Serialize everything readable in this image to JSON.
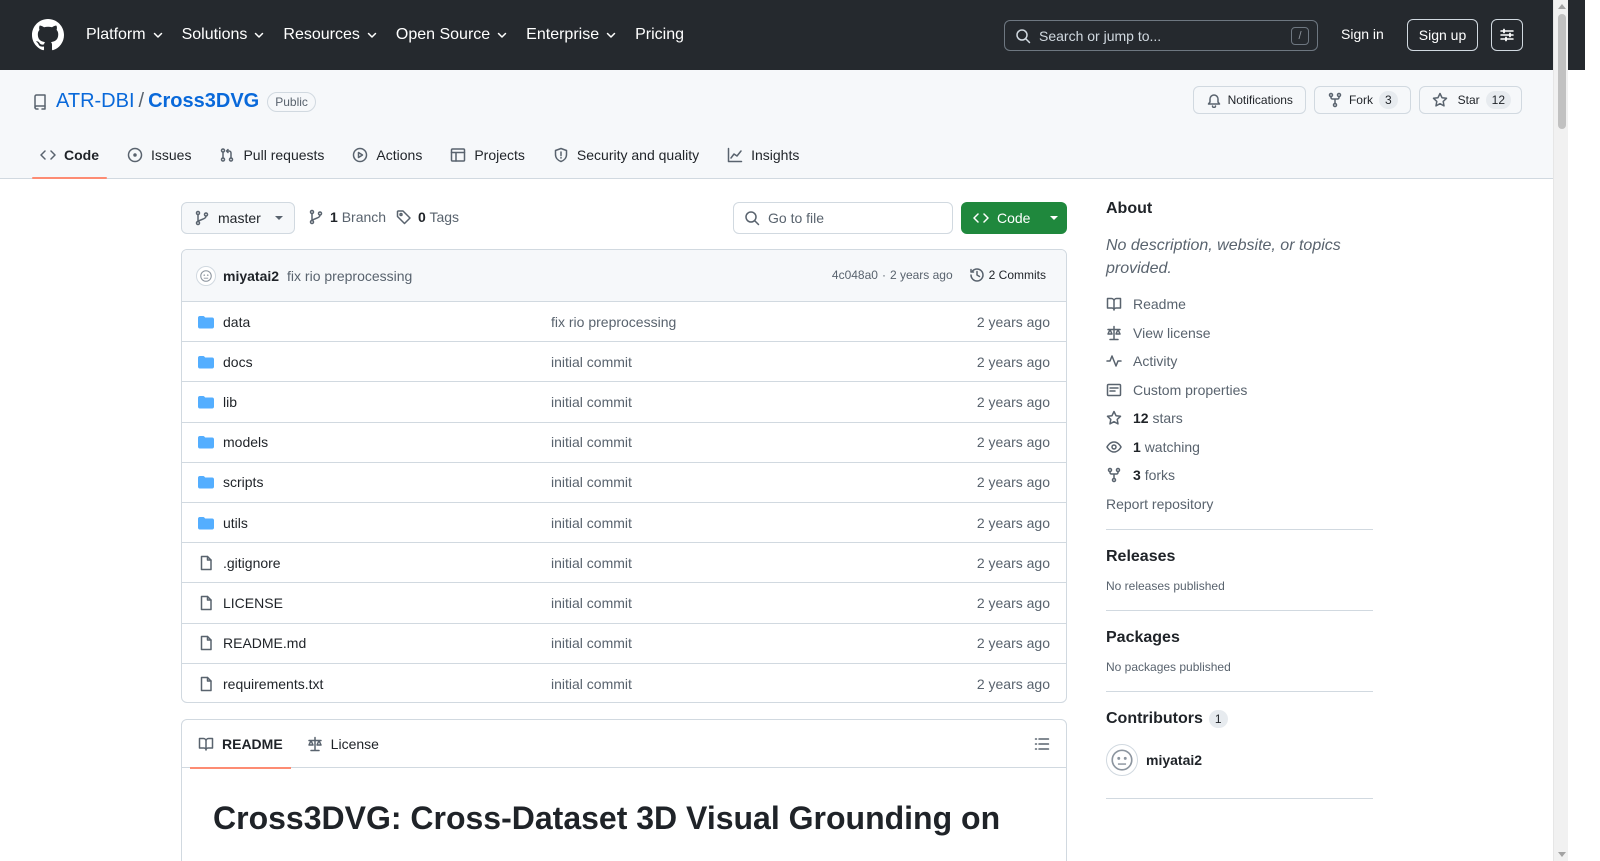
{
  "header": {
    "nav": [
      {
        "label": "Platform",
        "dropdown": true
      },
      {
        "label": "Solutions",
        "dropdown": true
      },
      {
        "label": "Resources",
        "dropdown": true
      },
      {
        "label": "Open Source",
        "dropdown": true
      },
      {
        "label": "Enterprise",
        "dropdown": true
      },
      {
        "label": "Pricing",
        "dropdown": false
      }
    ],
    "search_placeholder": "Search or jump to...",
    "search_shortcut": "/",
    "sign_in": "Sign in",
    "sign_up": "Sign up"
  },
  "repo": {
    "owner": "ATR-DBI",
    "separator": "/",
    "name": "Cross3DVG",
    "visibility": "Public",
    "notifications_label": "Notifications",
    "fork_label": "Fork",
    "fork_count": "3",
    "star_label": "Star",
    "star_count": "12",
    "tabs": [
      {
        "label": "Code",
        "icon": "code-icon",
        "active": true
      },
      {
        "label": "Issues",
        "icon": "issue-icon",
        "active": false
      },
      {
        "label": "Pull requests",
        "icon": "pull-request-icon",
        "active": false
      },
      {
        "label": "Actions",
        "icon": "play-icon",
        "active": false
      },
      {
        "label": "Projects",
        "icon": "table-icon",
        "active": false
      },
      {
        "label": "Security and quality",
        "icon": "shield-icon",
        "active": false
      },
      {
        "label": "Insights",
        "icon": "graph-icon",
        "active": false
      }
    ]
  },
  "toolbar": {
    "branch": "master",
    "branch_count": "1",
    "branch_label": "Branch",
    "tag_count": "0",
    "tag_label": "Tags",
    "goto_placeholder": "Go to file",
    "code_button": "Code"
  },
  "commit": {
    "author": "miyatai2",
    "message": "fix rio preprocessing",
    "hash": "4c048a0",
    "separator": "·",
    "time": "2 years ago",
    "commits_label": "2 Commits"
  },
  "files": [
    {
      "name": "data",
      "type": "folder",
      "message": "fix rio preprocessing",
      "time": "2 years ago"
    },
    {
      "name": "docs",
      "type": "folder",
      "message": "initial commit",
      "time": "2 years ago"
    },
    {
      "name": "lib",
      "type": "folder",
      "message": "initial commit",
      "time": "2 years ago"
    },
    {
      "name": "models",
      "type": "folder",
      "message": "initial commit",
      "time": "2 years ago"
    },
    {
      "name": "scripts",
      "type": "folder",
      "message": "initial commit",
      "time": "2 years ago"
    },
    {
      "name": "utils",
      "type": "folder",
      "message": "initial commit",
      "time": "2 years ago"
    },
    {
      "name": ".gitignore",
      "type": "file",
      "message": "initial commit",
      "time": "2 years ago"
    },
    {
      "name": "LICENSE",
      "type": "file",
      "message": "initial commit",
      "time": "2 years ago"
    },
    {
      "name": "README.md",
      "type": "file",
      "message": "initial commit",
      "time": "2 years ago"
    },
    {
      "name": "requirements.txt",
      "type": "file",
      "message": "initial commit",
      "time": "2 years ago"
    }
  ],
  "readme": {
    "tab_readme": "README",
    "tab_license": "License",
    "heading": "Cross3DVG: Cross-Dataset 3D Visual Grounding on"
  },
  "sidebar": {
    "about_title": "About",
    "about_desc": "No description, website, or topics provided.",
    "links": {
      "readme": "Readme",
      "license": "View license",
      "activity": "Activity",
      "custom_properties": "Custom properties",
      "stars_count": "12",
      "stars_label": "stars",
      "watching_count": "1",
      "watching_label": "watching",
      "forks_count": "3",
      "forks_label": "forks"
    },
    "report": "Report repository",
    "releases_title": "Releases",
    "releases_empty": "No releases published",
    "packages_title": "Packages",
    "packages_empty": "No packages published",
    "contributors_title": "Contributors",
    "contributors_count": "1",
    "contributor_name": "miyatai2"
  },
  "colors": {
    "header_bg": "#25292e",
    "link": "#0969da",
    "primary_button": "#1f883d",
    "active_tab_underline": "#fd8c73",
    "folder_icon": "#54aeff"
  }
}
